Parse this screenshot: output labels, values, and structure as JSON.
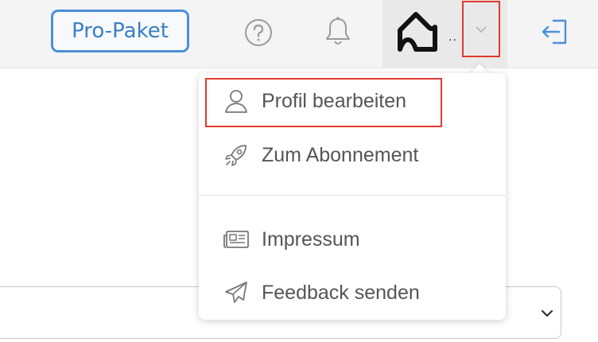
{
  "header": {
    "pro_button_label": "Pro-Paket",
    "account_ellipsis": "..",
    "icons": [
      "help-icon",
      "bell-icon",
      "home-logo-icon",
      "chevron-down-icon",
      "logout-icon"
    ]
  },
  "dropdown": {
    "items": [
      {
        "label": "Profil bearbeiten",
        "icon": "user-icon"
      },
      {
        "label": "Zum Abonnement",
        "icon": "rocket-icon"
      },
      {
        "label": "Impressum",
        "icon": "newspaper-icon"
      },
      {
        "label": "Feedback senden",
        "icon": "paper-plane-icon"
      }
    ]
  },
  "colors": {
    "accent": "#4a90d9",
    "highlight": "#e03a2f",
    "topbar_bg": "#f4f4f4",
    "text": "#555555"
  }
}
